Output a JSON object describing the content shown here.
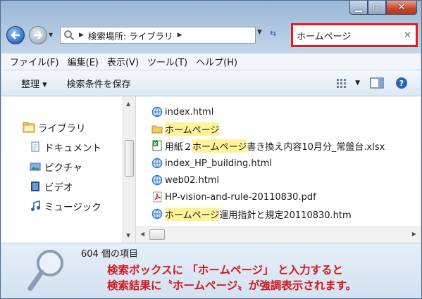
{
  "window": {
    "min_icon": "minimize-icon",
    "max_icon": "maximize-icon",
    "close_icon": "close-icon"
  },
  "address": {
    "location": "検索場所: ライブラリ"
  },
  "search": {
    "query": "ホームページ",
    "clear_icon": "clear-icon"
  },
  "menu": [
    "ファイル(F)",
    "編集(E)",
    "表示(V)",
    "ツール(T)",
    "ヘルプ(H)"
  ],
  "toolbar": {
    "organize": "整理 ▾",
    "save_search": "検索条件を保存"
  },
  "nav": {
    "items": [
      "ライブラリ",
      "ドキュメント",
      "ピクチャ",
      "ビデオ",
      "ミュージック"
    ]
  },
  "files": [
    {
      "type": "html",
      "parts": [
        "index.html"
      ],
      "hl": [
        false
      ]
    },
    {
      "type": "folder",
      "parts": [
        "ホームページ"
      ],
      "hl": [
        true
      ]
    },
    {
      "type": "excel",
      "parts": [
        "用紙２",
        "ホームページ",
        "書き換え内容10月分_常盤台.xlsx"
      ],
      "hl": [
        false,
        true,
        false
      ]
    },
    {
      "type": "html",
      "parts": [
        "index_HP_building.html"
      ],
      "hl": [
        false
      ]
    },
    {
      "type": "html",
      "parts": [
        "web02.html"
      ],
      "hl": [
        false
      ]
    },
    {
      "type": "pdf",
      "parts": [
        "HP-vision-and-rule-20110830.pdf"
      ],
      "hl": [
        false
      ]
    },
    {
      "type": "html",
      "parts": [
        "ホームページ",
        "運用指針と規定20110830.htm"
      ],
      "hl": [
        true,
        false
      ]
    }
  ],
  "details": {
    "count": "604 個の項目",
    "note_line1": "検索ボックスに 「ホームページ」 と入力すると",
    "note_line2": "検索結果に〝ホームページ〟が強調表示されます。"
  },
  "colors": {
    "highlight": "#fff39a",
    "note": "#d4161c",
    "search_border": "#e8191a"
  }
}
